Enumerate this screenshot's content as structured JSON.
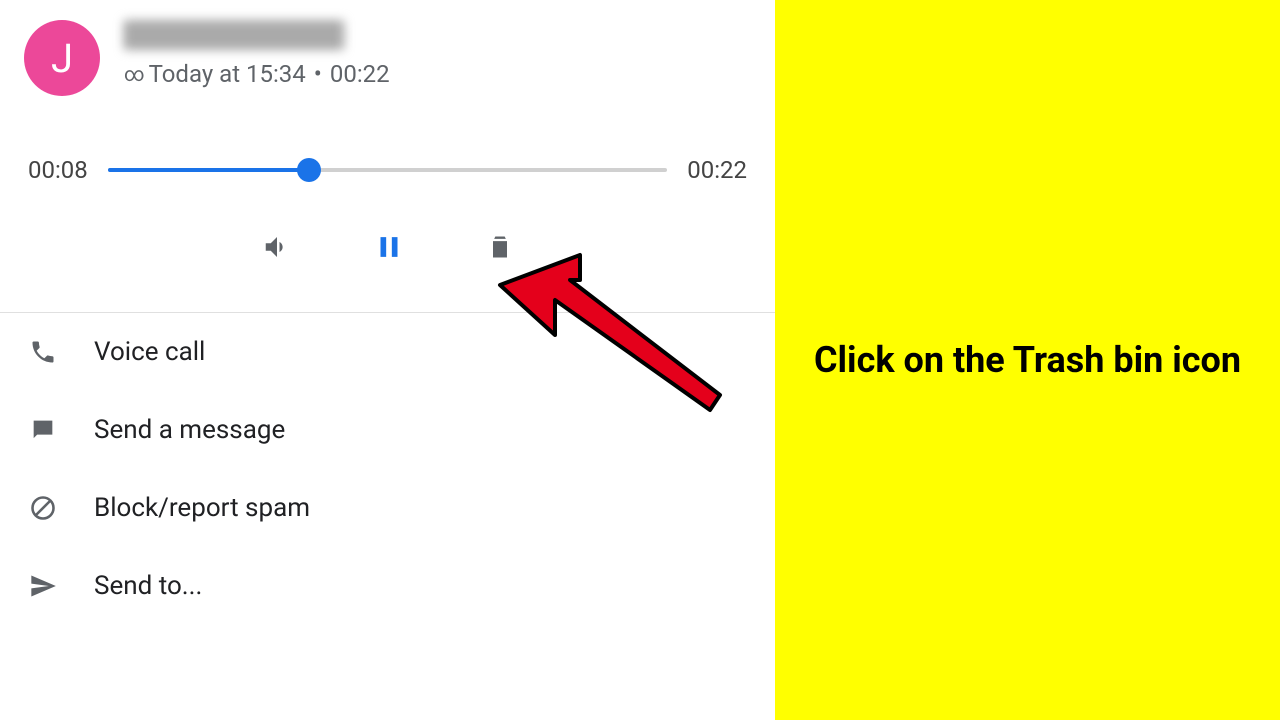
{
  "header": {
    "avatar_letter": "J",
    "voicemail_indicator": "∞",
    "timestamp": "Today at 15:34",
    "separator": "•",
    "duration": "00:22"
  },
  "playback": {
    "current_time": "00:08",
    "total_time": "00:22",
    "progress_percent": 36
  },
  "actions": {
    "voice_call": "Voice call",
    "send_message": "Send a message",
    "block_spam": "Block/report spam",
    "send_to": "Send to..."
  },
  "instruction": "Click on the Trash bin icon"
}
